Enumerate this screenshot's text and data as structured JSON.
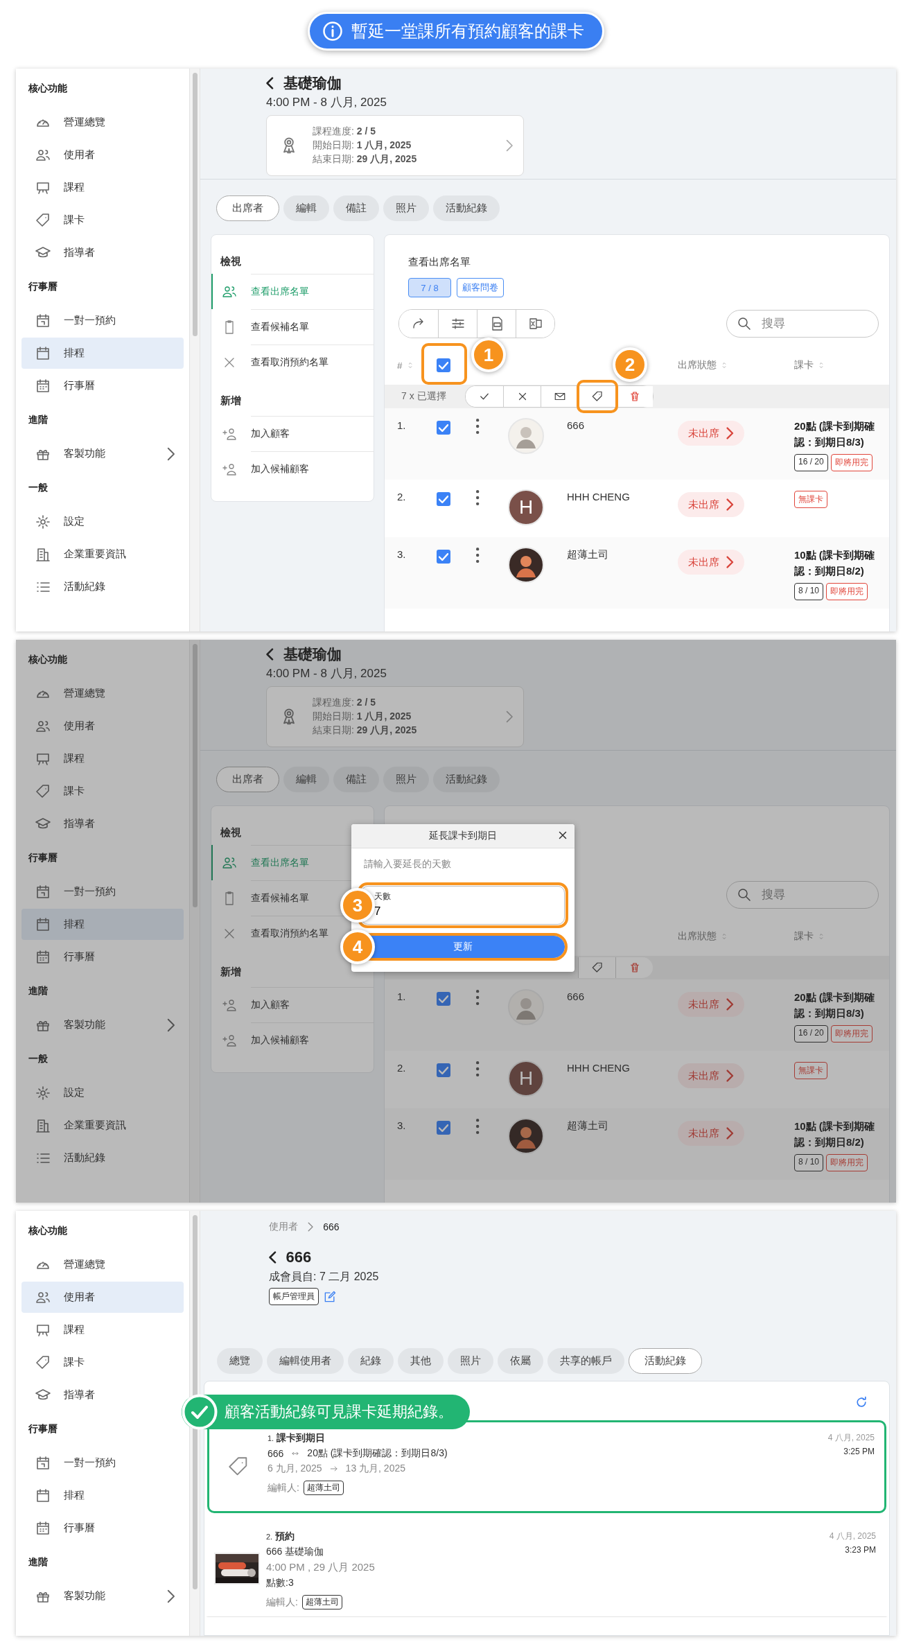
{
  "banner": {
    "text": "暫延一堂課所有預約顧客的課卡"
  },
  "panels": [
    {
      "kind": "course",
      "sidebar": [
        {
          "heading": "核心功能",
          "items": [
            {
              "label": "營運總覽",
              "selected": false,
              "expandable": false
            },
            {
              "label": "使用者",
              "selected": false,
              "expandable": false
            },
            {
              "label": "課程",
              "selected": false,
              "expandable": false
            },
            {
              "label": "課卡",
              "selected": false,
              "expandable": false
            },
            {
              "label": "指導者",
              "selected": false,
              "expandable": false
            }
          ]
        },
        {
          "heading": "行事曆",
          "items": [
            {
              "label": "一對一預約",
              "selected": false,
              "expandable": false
            },
            {
              "label": "排程",
              "selected": true,
              "expandable": false
            },
            {
              "label": "行事曆",
              "selected": false,
              "expandable": false
            }
          ]
        },
        {
          "heading": "進階",
          "items": [
            {
              "label": "客製功能",
              "selected": false,
              "expandable": true
            }
          ]
        },
        {
          "heading": "一般",
          "items": [
            {
              "label": "設定",
              "selected": false,
              "expandable": false
            },
            {
              "label": "企業重要資訊",
              "selected": false,
              "expandable": false
            },
            {
              "label": "活動紀錄",
              "selected": false,
              "expandable": false
            }
          ]
        }
      ],
      "header": {
        "title": "基礎瑜伽",
        "subtitle": "4:00 PM - 8 八月, 2025"
      },
      "info": [
        "課程進度: **2 / 5**",
        "開始日期: **1 八月, 2025**",
        "結束日期: **29 八月, 2025**"
      ],
      "tabs": [
        {
          "label": "出席者",
          "selected": true
        },
        {
          "label": "編輯",
          "selected": false
        },
        {
          "label": "備註",
          "selected": false
        },
        {
          "label": "照片",
          "selected": false
        },
        {
          "label": "活動紀錄",
          "selected": false
        }
      ],
      "menu": [
        {
          "heading": "檢視",
          "items": [
            {
              "label": "查看出席名單",
              "selected": true
            },
            {
              "label": "查看候補名單",
              "selected": false
            },
            {
              "label": "查看取消預約名單",
              "selected": false
            }
          ]
        },
        {
          "heading": "新增",
          "items": [
            {
              "label": "加入顧客",
              "selected": false
            },
            {
              "label": "加入候補顧客",
              "selected": false
            }
          ]
        }
      ],
      "list": {
        "title": "查看出席名單",
        "chips": [
          {
            "label": "7 / 8",
            "selected": true
          },
          {
            "label": "顧客問卷",
            "selected": false
          }
        ],
        "search": {
          "placeholder": "搜尋"
        },
        "header": {
          "index": "#",
          "checked": true,
          "status": "出席狀態",
          "card": "課卡",
          "step": "1"
        },
        "selected_label": "7 x 已選擇",
        "tag_step": "2",
        "rows": [
          {
            "index": "1.",
            "checked": true,
            "name": "666",
            "status": "未出席",
            "card": {
              "title": "20點 (課卡到期確認：到期日8/3)",
              "usage": "16 / 20",
              "warning": "即將用完"
            }
          },
          {
            "index": "2.",
            "checked": true,
            "avatar": {
              "kind": "letter",
              "letter": "H"
            },
            "name": "HHH CHENG",
            "status": "未出席",
            "card": {
              "warning": "無課卡"
            }
          },
          {
            "index": "3.",
            "checked": true,
            "name": "超薄土司",
            "status": "未出席",
            "card": {
              "title": "10點 (課卡到期確認：到期日8/2)",
              "usage": "8 / 10",
              "warning": "即將用完"
            }
          }
        ]
      }
    },
    {
      "kind": "course",
      "sidebar": [
        {
          "heading": "核心功能",
          "items": [
            {
              "label": "營運總覽",
              "selected": false,
              "expandable": false
            },
            {
              "label": "使用者",
              "selected": false,
              "expandable": false
            },
            {
              "label": "課程",
              "selected": false,
              "expandable": false
            },
            {
              "label": "課卡",
              "selected": false,
              "expandable": false
            },
            {
              "label": "指導者",
              "selected": false,
              "expandable": false
            }
          ]
        },
        {
          "heading": "行事曆",
          "items": [
            {
              "label": "一對一預約",
              "selected": false,
              "expandable": false
            },
            {
              "label": "排程",
              "selected": true,
              "expandable": false
            },
            {
              "label": "行事曆",
              "selected": false,
              "expandable": false
            }
          ]
        },
        {
          "heading": "進階",
          "items": [
            {
              "label": "客製功能",
              "selected": false,
              "expandable": true
            }
          ]
        },
        {
          "heading": "一般",
          "items": [
            {
              "label": "設定",
              "selected": false,
              "expandable": false
            },
            {
              "label": "企業重要資訊",
              "selected": false,
              "expandable": false
            },
            {
              "label": "活動紀錄",
              "selected": false,
              "expandable": false
            }
          ]
        }
      ],
      "header": {
        "title": "基礎瑜伽",
        "subtitle": "4:00 PM - 8 八月, 2025"
      },
      "info": [
        "課程進度: **2 / 5**",
        "開始日期: **1 八月, 2025**",
        "結束日期: **29 八月, 2025**"
      ],
      "tabs": [
        {
          "label": "出席者",
          "selected": true
        },
        {
          "label": "編輯",
          "selected": false
        },
        {
          "label": "備註",
          "selected": false
        },
        {
          "label": "照片",
          "selected": false
        },
        {
          "label": "活動紀錄",
          "selected": false
        }
      ],
      "menu": [
        {
          "heading": "檢視",
          "items": [
            {
              "label": "查看出席名單",
              "selected": true
            },
            {
              "label": "查看候補名單",
              "selected": false
            },
            {
              "label": "查看取消預約名單",
              "selected": false
            }
          ]
        },
        {
          "heading": "新增",
          "items": [
            {
              "label": "加入顧客",
              "selected": false
            },
            {
              "label": "加入候補顧客",
              "selected": false
            }
          ]
        }
      ],
      "list": {
        "search": {
          "placeholder": "搜尋"
        },
        "header": {
          "status": "出席狀態",
          "card": "課卡"
        },
        "rows": [
          {
            "index": "1.",
            "checked": true,
            "name": "666",
            "status": "未出席",
            "card": {
              "title": "20點 (課卡到期確認：到期日8/3)",
              "usage": "16 / 20",
              "warning": "即將用完"
            }
          },
          {
            "index": "2.",
            "checked": true,
            "avatar": {
              "kind": "letter",
              "letter": "H"
            },
            "name": "HHH CHENG",
            "status": "未出席",
            "card": {
              "warning": "無課卡"
            }
          },
          {
            "index": "3.",
            "checked": true,
            "name": "超薄土司",
            "status": "未出席",
            "card": {
              "title": "10點 (課卡到期確認：到期日8/2)",
              "usage": "8 / 10",
              "warning": "即將用完"
            }
          }
        ]
      },
      "dialog": {
        "title": "延長課卡到期日",
        "hint": "請輸入要延長的天數",
        "field": {
          "label": "天數",
          "value": "7",
          "step": "3"
        },
        "button": {
          "label": "更新",
          "step": "4"
        }
      }
    },
    {
      "kind": "user",
      "sidebar": [
        {
          "heading": "核心功能",
          "items": [
            {
              "label": "營運總覽",
              "selected": false,
              "expandable": false
            },
            {
              "label": "使用者",
              "selected": true,
              "expandable": false
            },
            {
              "label": "課程",
              "selected": false,
              "expandable": false
            },
            {
              "label": "課卡",
              "selected": false,
              "expandable": false
            },
            {
              "label": "指導者",
              "selected": false,
              "expandable": false
            }
          ]
        },
        {
          "heading": "行事曆",
          "items": [
            {
              "label": "一對一預約",
              "selected": false,
              "expandable": false
            },
            {
              "label": "排程",
              "selected": false,
              "expandable": false
            },
            {
              "label": "行事曆",
              "selected": false,
              "expandable": false
            }
          ]
        },
        {
          "heading": "進階",
          "items": [
            {
              "label": "客製功能",
              "selected": false,
              "expandable": true
            }
          ]
        }
      ],
      "breadcrumb": [
        "使用者",
        "666"
      ],
      "header": {
        "title": "666",
        "subtitle": "成會員自: 7 二月 2025",
        "role": "帳戶管理員"
      },
      "tabs": [
        {
          "label": "總覽",
          "selected": false
        },
        {
          "label": "編輯使用者",
          "selected": false
        },
        {
          "label": "紀錄",
          "selected": false
        },
        {
          "label": "其他",
          "selected": false
        },
        {
          "label": "照片",
          "selected": false
        },
        {
          "label": "依屬",
          "selected": false
        },
        {
          "label": "共享的帳戶",
          "selected": false
        },
        {
          "label": "活動紀錄",
          "selected": true
        }
      ],
      "callout": {
        "text": "顧客活動紀錄可見課卡延期紀錄。"
      },
      "activities": [
        {
          "kind": "card_expiry",
          "highlighted": true,
          "index": "1.",
          "title": "課卡到期日",
          "user": "666",
          "card": "20點 (課卡到期確認：到期日8/3)",
          "from": "6 九月, 2025",
          "to": "13 九月, 2025",
          "editor_label": "編輯人:",
          "editor": "超薄土司",
          "date": "4 八月, 2025",
          "time": "3:25 PM"
        },
        {
          "kind": "booking",
          "highlighted": false,
          "index": "2.",
          "title": "預約",
          "summary": "666 基礎瑜伽",
          "when": "4:00 PM , 29 八月 2025",
          "points": "點數:3",
          "editor_label": "編輯人:",
          "editor": "超薄土司",
          "date": "4 八月, 2025",
          "time": "3:23 PM"
        }
      ]
    }
  ]
}
